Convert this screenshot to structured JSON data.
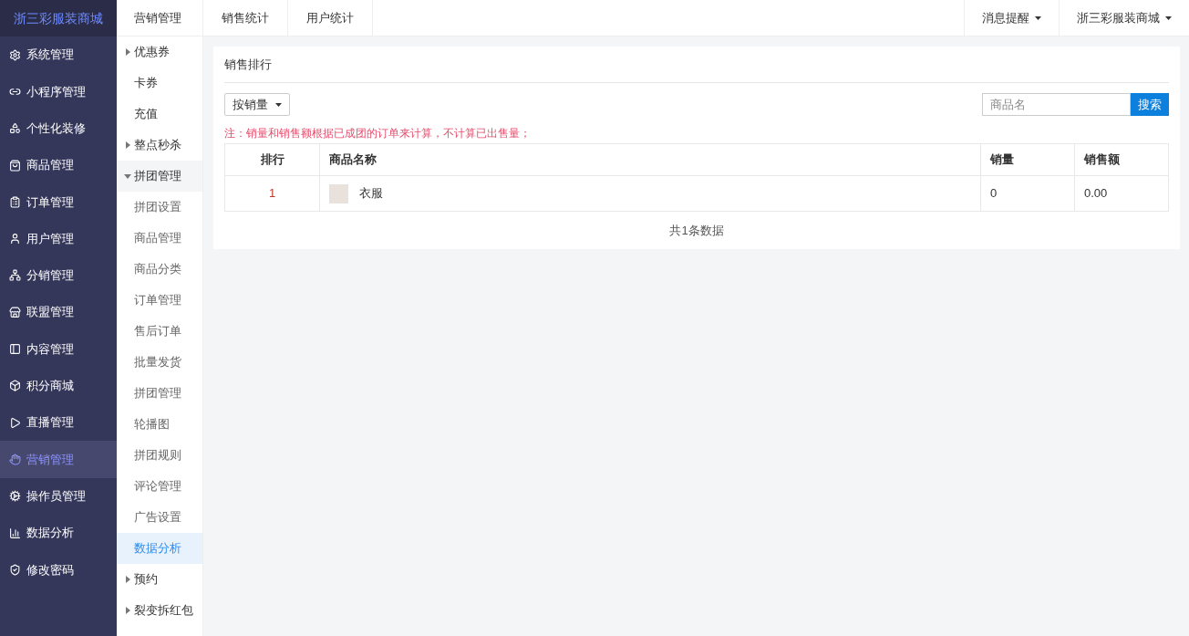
{
  "sidebar": {
    "logo": "浙三彩服装商城",
    "items": [
      {
        "label": "系统管理",
        "selected": false
      },
      {
        "label": "小程序管理",
        "selected": false
      },
      {
        "label": "个性化装修",
        "selected": false
      },
      {
        "label": "商品管理",
        "selected": false
      },
      {
        "label": "订单管理",
        "selected": false
      },
      {
        "label": "用户管理",
        "selected": false
      },
      {
        "label": "分销管理",
        "selected": false
      },
      {
        "label": "联盟管理",
        "selected": false
      },
      {
        "label": "内容管理",
        "selected": false
      },
      {
        "label": "积分商城",
        "selected": false
      },
      {
        "label": "直播管理",
        "selected": false
      },
      {
        "label": "营销管理",
        "selected": true
      },
      {
        "label": "操作员管理",
        "selected": false
      },
      {
        "label": "数据分析",
        "selected": false
      },
      {
        "label": "修改密码",
        "selected": false
      }
    ]
  },
  "subnav": {
    "title": "营销管理",
    "items": [
      {
        "kind": "group",
        "label": "优惠券",
        "expanded": false
      },
      {
        "kind": "link",
        "label": "卡券",
        "selected": false
      },
      {
        "kind": "link",
        "label": "充值",
        "selected": false
      },
      {
        "kind": "group",
        "label": "整点秒杀",
        "expanded": false
      },
      {
        "kind": "group",
        "label": "拼团管理",
        "expanded": true,
        "children": [
          {
            "label": "拼团设置",
            "selected": false
          },
          {
            "label": "商品管理",
            "selected": false
          },
          {
            "label": "商品分类",
            "selected": false
          },
          {
            "label": "订单管理",
            "selected": false
          },
          {
            "label": "售后订单",
            "selected": false
          },
          {
            "label": "批量发货",
            "selected": false
          },
          {
            "label": "拼团管理",
            "selected": false
          },
          {
            "label": "轮播图",
            "selected": false
          },
          {
            "label": "拼团规则",
            "selected": false
          },
          {
            "label": "评论管理",
            "selected": false
          },
          {
            "label": "广告设置",
            "selected": false
          },
          {
            "label": "数据分析",
            "selected": true
          }
        ]
      },
      {
        "kind": "group",
        "label": "预约",
        "expanded": false
      },
      {
        "kind": "group",
        "label": "裂变拆红包",
        "expanded": false
      }
    ]
  },
  "topbar": {
    "tabs": [
      "销售统计",
      "用户统计"
    ],
    "menus": [
      "消息提醒",
      "浙三彩服装商城"
    ]
  },
  "card": {
    "title": "销售排行",
    "sort": "按销量",
    "search": {
      "placeholder": "商品名",
      "button": "搜索"
    },
    "note": "注：销量和销售额根据已成团的订单来计算，不计算已出售量；",
    "table": {
      "columns": [
        "排行",
        "商品名称",
        "销量",
        "销售额"
      ],
      "rows": [
        {
          "rank": "1",
          "name": "衣服",
          "sales": "0",
          "amount": "0.00"
        }
      ]
    },
    "footer": "共1条数据"
  }
}
